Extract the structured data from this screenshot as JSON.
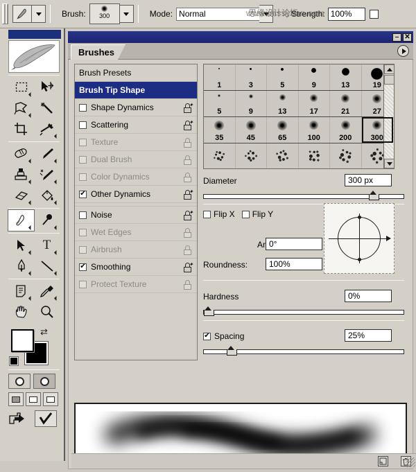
{
  "options_bar": {
    "tool_icon": "brush-tool-icon",
    "tool_preset_caret": "chevron-down-icon",
    "brush_label": "Brush:",
    "brush_size_value": "300",
    "mode_label": "Mode:",
    "mode_value": "Normal",
    "strength_label": "Strength:",
    "strength_value": "100%",
    "watermark": "www.missyuan.com",
    "watermark_cn": "思缘设计论坛"
  },
  "toolbox": {
    "tools": [
      {
        "name": "marquee-tool",
        "glyph": "▭"
      },
      {
        "name": "move-tool",
        "glyph": "✥"
      },
      {
        "name": "lasso-tool",
        "glyph": "✑"
      },
      {
        "name": "magic-wand-tool",
        "glyph": "✦"
      },
      {
        "name": "crop-tool",
        "glyph": "⌗"
      },
      {
        "name": "slice-tool",
        "glyph": "✂"
      },
      {
        "name": "healing-brush-tool",
        "glyph": "◠"
      },
      {
        "name": "brush-tool",
        "glyph": "✎"
      },
      {
        "name": "clone-stamp-tool",
        "glyph": "⎈"
      },
      {
        "name": "history-brush-tool",
        "glyph": "✒"
      },
      {
        "name": "eraser-tool",
        "glyph": "▱"
      },
      {
        "name": "gradient-tool",
        "glyph": "◨"
      },
      {
        "name": "blur-tool",
        "glyph": "◌"
      },
      {
        "name": "dodge-tool",
        "glyph": "◑"
      },
      {
        "name": "path-selection-tool",
        "glyph": "➤"
      },
      {
        "name": "type-tool",
        "glyph": "T"
      },
      {
        "name": "pen-tool",
        "glyph": "✑"
      },
      {
        "name": "line-tool",
        "glyph": "╲"
      },
      {
        "name": "notes-tool",
        "glyph": "▤"
      },
      {
        "name": "eyedropper-tool",
        "glyph": "⌐"
      },
      {
        "name": "hand-tool",
        "glyph": "✋"
      },
      {
        "name": "zoom-tool",
        "glyph": "⌕"
      }
    ],
    "foreground_color": "#ffffff",
    "background_color": "#000000",
    "swap_icon": "swap-colors-icon",
    "reset_icon": "default-colors-icon",
    "quickmask_standard": "standard-mode-icon",
    "quickmask_quick": "quick-mask-mode-icon",
    "screen_modes": [
      "standard-screen-mode",
      "full-screen-menubar-mode",
      "full-screen-mode"
    ],
    "jump_to_imageready": "jump-to-imageready-icon",
    "confirm": "confirm-check-icon"
  },
  "palette": {
    "title_minimize": "–",
    "title_close": "✕",
    "tab_label": "Brushes",
    "menu_icon": "palette-menu-icon"
  },
  "option_list": [
    {
      "label": "Brush Presets",
      "type": "preset",
      "checked": null,
      "enabled": true,
      "active": false,
      "locked": false
    },
    {
      "label": "Brush Tip Shape",
      "type": "header",
      "checked": null,
      "enabled": true,
      "active": true,
      "locked": false
    },
    {
      "label": "Shape Dynamics",
      "type": "check",
      "checked": false,
      "enabled": true,
      "active": false,
      "locked": false
    },
    {
      "label": "Scattering",
      "type": "check",
      "checked": false,
      "enabled": true,
      "active": false,
      "locked": false
    },
    {
      "label": "Texture",
      "type": "check",
      "checked": false,
      "enabled": false,
      "active": false,
      "locked": true
    },
    {
      "label": "Dual Brush",
      "type": "check",
      "checked": false,
      "enabled": false,
      "active": false,
      "locked": true
    },
    {
      "label": "Color Dynamics",
      "type": "check",
      "checked": false,
      "enabled": false,
      "active": false,
      "locked": true
    },
    {
      "label": "Other Dynamics",
      "type": "check",
      "checked": true,
      "enabled": true,
      "active": false,
      "locked": false
    },
    {
      "label": "Noise",
      "type": "check",
      "checked": false,
      "enabled": true,
      "active": false,
      "locked": false
    },
    {
      "label": "Wet Edges",
      "type": "check",
      "checked": false,
      "enabled": false,
      "active": false,
      "locked": true
    },
    {
      "label": "Airbrush",
      "type": "check",
      "checked": false,
      "enabled": false,
      "active": false,
      "locked": true
    },
    {
      "label": "Smoothing",
      "type": "check",
      "checked": true,
      "enabled": true,
      "active": false,
      "locked": false
    },
    {
      "label": "Protect Texture",
      "type": "check",
      "checked": false,
      "enabled": false,
      "active": false,
      "locked": true
    }
  ],
  "brush_grid": {
    "selected": "300",
    "rows": [
      [
        {
          "label": "1",
          "size": 2,
          "hard": true
        },
        {
          "label": "3",
          "size": 3,
          "hard": true
        },
        {
          "label": "5",
          "size": 4,
          "hard": true
        },
        {
          "label": "9",
          "size": 7,
          "hard": true
        },
        {
          "label": "13",
          "size": 11,
          "hard": true
        },
        {
          "label": "19",
          "size": 17,
          "hard": true
        }
      ],
      [
        {
          "label": "5",
          "size": 4,
          "hard": false
        },
        {
          "label": "9",
          "size": 6,
          "hard": false
        },
        {
          "label": "13",
          "size": 9,
          "hard": false
        },
        {
          "label": "17",
          "size": 11,
          "hard": false
        },
        {
          "label": "21",
          "size": 12,
          "hard": false
        },
        {
          "label": "27",
          "size": 13,
          "hard": false
        }
      ],
      [
        {
          "label": "35",
          "size": 14,
          "hard": false
        },
        {
          "label": "45",
          "size": 14,
          "hard": false
        },
        {
          "label": "65",
          "size": 14,
          "hard": false
        },
        {
          "label": "100",
          "size": 13,
          "hard": false
        },
        {
          "label": "200",
          "size": 13,
          "hard": false
        },
        {
          "label": "300",
          "size": 13,
          "hard": false
        }
      ]
    ],
    "scroll_up_icon": "scroll-up-arrow-icon",
    "scroll_down_icon": "scroll-down-arrow-icon"
  },
  "controls": {
    "diameter_label": "Diameter",
    "diameter_value": "300 px",
    "diameter_percent": 86,
    "flip_x_label": "Flip X",
    "flip_x_checked": false,
    "flip_y_label": "Flip Y",
    "flip_y_checked": false,
    "angle_label": "Angle:",
    "angle_value": "0°",
    "roundness_label": "Roundness:",
    "roundness_value": "100%",
    "hardness_label": "Hardness",
    "hardness_value": "0%",
    "hardness_percent": 0,
    "spacing_label": "Spacing",
    "spacing_checked": true,
    "spacing_value": "25%",
    "spacing_percent": 12
  },
  "footer": {
    "new_brush_icon": "new-brush-icon",
    "delete_brush_icon": "trash-icon"
  }
}
